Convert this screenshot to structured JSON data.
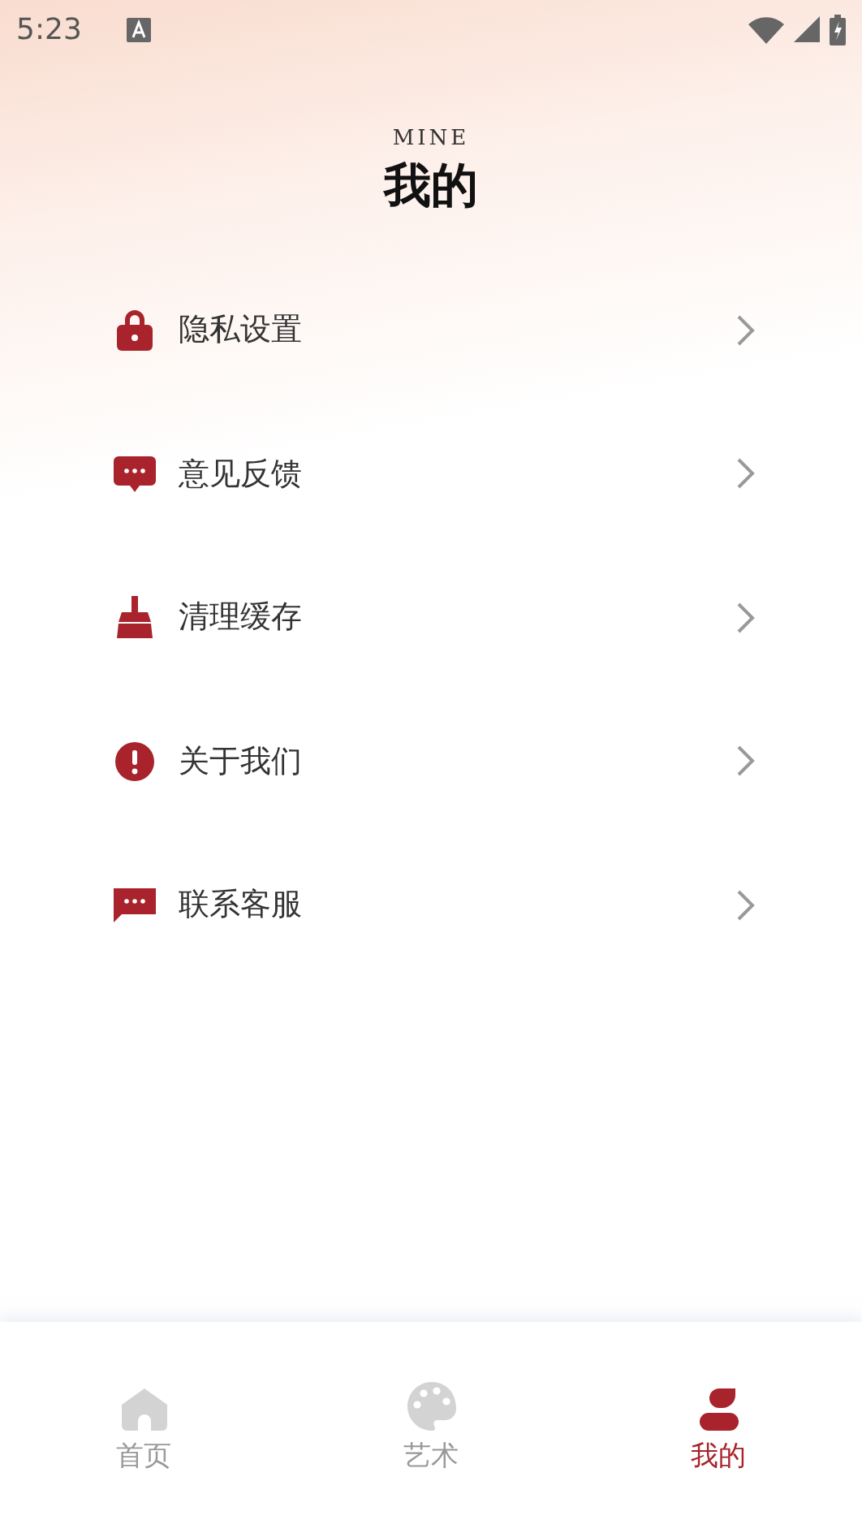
{
  "status_bar": {
    "time": "5:23"
  },
  "header": {
    "subtitle": "MINE",
    "title": "我的"
  },
  "menu": [
    {
      "kind": "lock",
      "label": "隐私设置"
    },
    {
      "kind": "feedback",
      "label": "意见反馈"
    },
    {
      "kind": "broom",
      "label": "清理缓存"
    },
    {
      "kind": "alert",
      "label": "关于我们"
    },
    {
      "kind": "message",
      "label": "联系客服"
    }
  ],
  "tabs": [
    {
      "kind": "home",
      "label": "首页",
      "selected": false
    },
    {
      "kind": "palette",
      "label": "艺术",
      "selected": false
    },
    {
      "kind": "person",
      "label": "我的",
      "selected": true
    }
  ]
}
